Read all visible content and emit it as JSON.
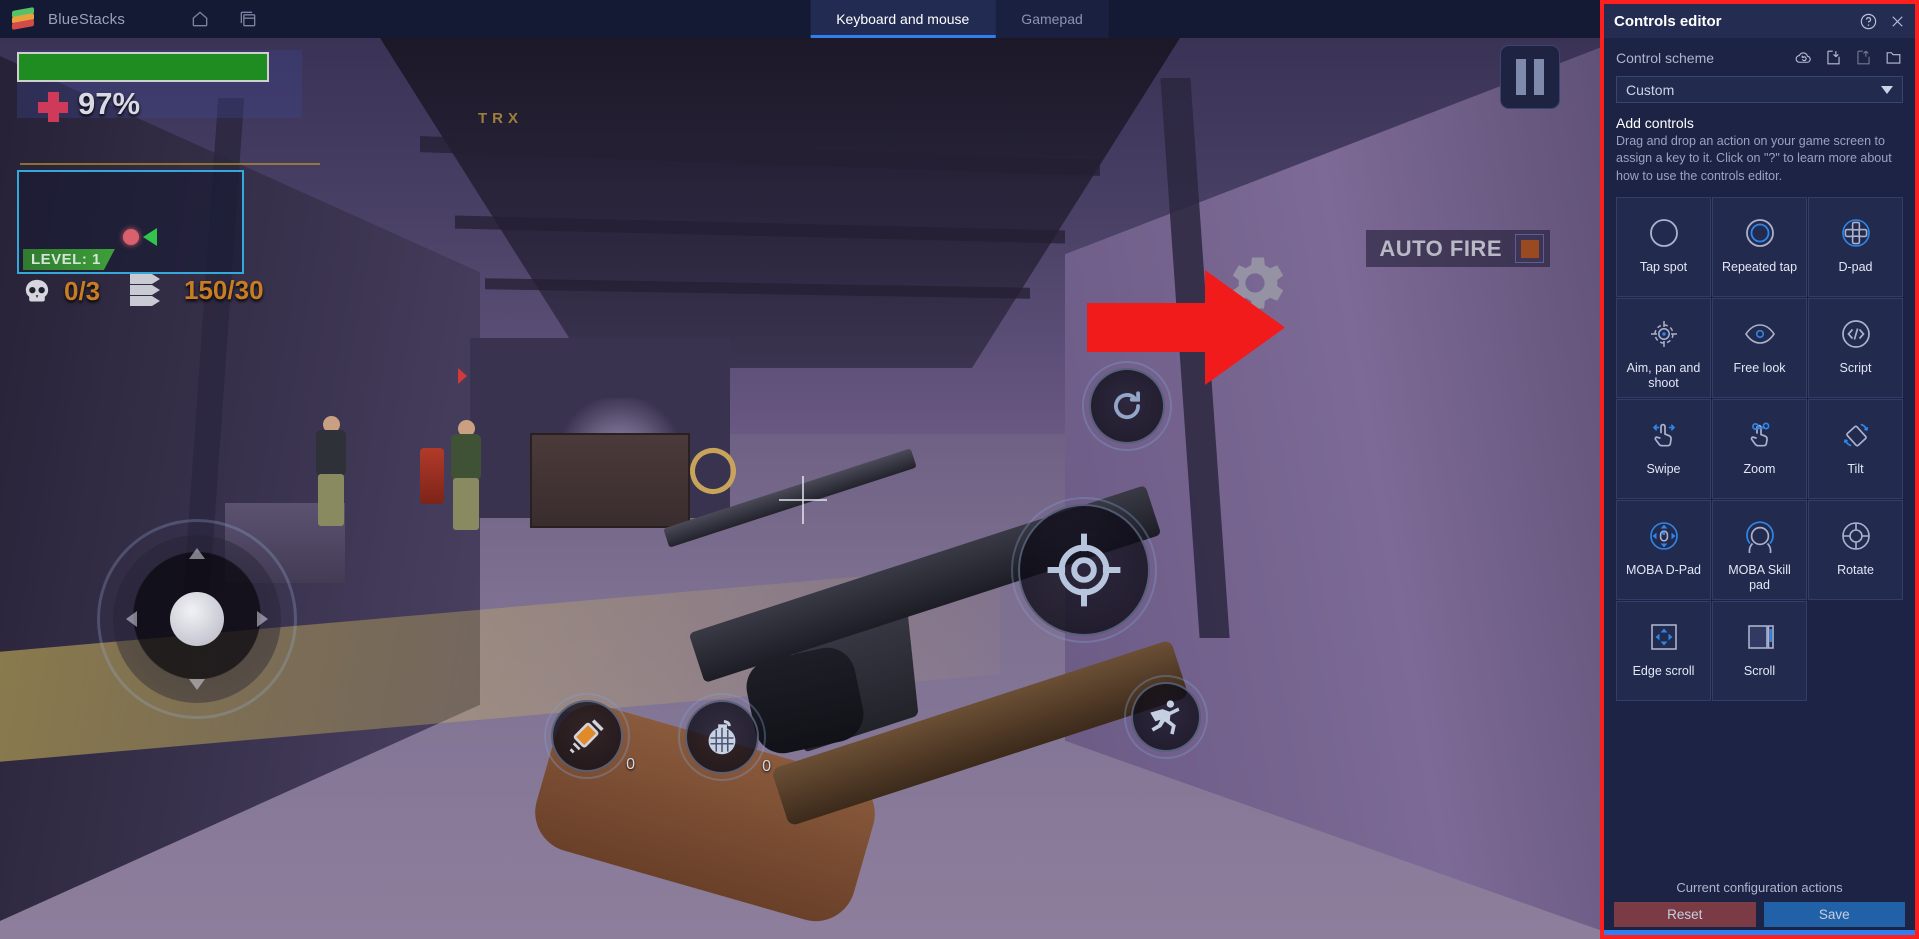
{
  "titlebar": {
    "app_name": "BlueStacks",
    "logo_icon": "bluestacks-logo",
    "home_icon": "home-icon",
    "multi_instance_icon": "multi-instance-icon",
    "help_icon": "help-circle-icon",
    "menu_icon": "hamburger-menu-icon",
    "minimize_icon": "minimize-icon",
    "maximize_icon": "maximize-icon",
    "close_icon": "close-icon"
  },
  "tabs": [
    {
      "label": "Keyboard and mouse",
      "active": true
    },
    {
      "label": "Gamepad",
      "active": false
    }
  ],
  "game": {
    "sign_text": "TRX",
    "health_percent": "97%",
    "health_icon": "medical-cross-icon",
    "minimap_level": "LEVEL: 1",
    "kill_counter": "0/3",
    "kill_icon": "skull-icon",
    "ammo_counter": "150/30",
    "ammo_icon": "bullets-icon",
    "auto_fire_label": "AUTO FIRE",
    "pause_icon": "pause-icon",
    "gear_icon": "gear-icon",
    "reload_icon": "reload-icon",
    "fire_icon": "crosshair-icon",
    "run_icon": "running-soldier-icon",
    "medkit_icon": "syringe-icon",
    "medkit_count": "0",
    "grenade_icon": "grenade-icon",
    "grenade_count": "0",
    "joystick_icon": "virtual-joystick",
    "annotation_arrow": "red-arrow-right"
  },
  "panel": {
    "title": "Controls editor",
    "help_icon": "help-circle-icon",
    "close_icon": "close-icon",
    "border_color": "#ff1f1f",
    "scheme": {
      "label": "Control scheme",
      "selected": "Custom",
      "icons": [
        "cloud-restore-icon",
        "import-icon",
        "export-icon",
        "folder-icon"
      ],
      "caret_icon": "chevron-down-icon"
    },
    "add_controls": {
      "title": "Add controls",
      "description": "Drag and drop an action on your game screen to assign a key to it. Click on \"?\" to learn more about how to use the controls editor."
    },
    "controls": [
      {
        "label": "Tap spot",
        "icon": "tap-spot-icon"
      },
      {
        "label": "Repeated tap",
        "icon": "repeated-tap-icon"
      },
      {
        "label": "D-pad",
        "icon": "d-pad-icon"
      },
      {
        "label": "Aim, pan and shoot",
        "icon": "aim-pan-shoot-icon"
      },
      {
        "label": "Free look",
        "icon": "free-look-icon"
      },
      {
        "label": "Script",
        "icon": "script-icon"
      },
      {
        "label": "Swipe",
        "icon": "swipe-icon"
      },
      {
        "label": "Zoom",
        "icon": "zoom-icon"
      },
      {
        "label": "Tilt",
        "icon": "tilt-icon"
      },
      {
        "label": "MOBA D-Pad",
        "icon": "moba-dpad-icon"
      },
      {
        "label": "MOBA Skill pad",
        "icon": "moba-skill-pad-icon"
      },
      {
        "label": "Rotate",
        "icon": "rotate-icon"
      },
      {
        "label": "Edge scroll",
        "icon": "edge-scroll-icon"
      },
      {
        "label": "Scroll",
        "icon": "scroll-icon"
      }
    ],
    "footer": {
      "title": "Current configuration actions",
      "reset_label": "Reset",
      "save_label": "Save",
      "reset_color": "#7a3b44",
      "save_color": "#2161a8"
    }
  }
}
